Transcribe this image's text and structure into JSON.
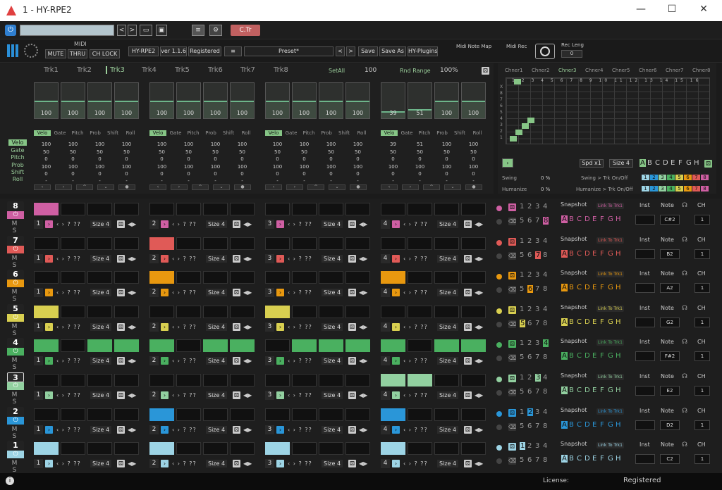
{
  "window": {
    "title": "1 - HY-RPE2",
    "min": "—",
    "max": "☐",
    "close": "✕"
  },
  "toolbar": {
    "ctr_label": "C.Tr",
    "prev": "<",
    "next": ">",
    "folder": "▭",
    "save": "▣"
  },
  "header": {
    "midi_label": "MIDI",
    "mute": "MUTE",
    "thru": "THRU",
    "chlock": "CH LOCK",
    "plugin": "HY-RPE2",
    "version": "ver 1.1.6",
    "registered": "Registered",
    "menu": "≡",
    "preset": "Preset*",
    "prev": "<",
    "next": ">",
    "save": "Save",
    "saveas": "Save As",
    "hyplugins": "HY-Plugins",
    "midinotemap": "Midi Note Map",
    "midirec": "Midi Rec",
    "recleng": "Rec Leng",
    "recleng_val": "0"
  },
  "tracks": {
    "tabs": [
      "Trk1",
      "Trk2",
      "Trk3",
      "Trk4",
      "Trk5",
      "Trk6",
      "Trk7",
      "Trk8"
    ],
    "active": "Trk3",
    "setall": "SetAll",
    "setall_val": "100",
    "rndrange": "Rnd Range",
    "rndrange_val": "100%",
    "sliders": [
      [
        "100",
        "100",
        "100",
        "100"
      ],
      [
        "100",
        "100",
        "100",
        "100"
      ],
      [
        "100",
        "100",
        "100",
        "100"
      ],
      [
        "39",
        "51",
        "100",
        "100"
      ]
    ],
    "fills": [
      [
        0.5,
        0.5,
        0.5,
        0.5
      ],
      [
        0.5,
        0.5,
        0.5,
        0.5
      ],
      [
        0.5,
        0.5,
        0.5,
        0.5
      ],
      [
        0.2,
        0.26,
        0.5,
        0.5
      ]
    ],
    "param_labels": [
      "Velo",
      "Gate",
      "Pitch",
      "Prob",
      "Shift",
      "Roll"
    ],
    "row_labels": [
      "Velo",
      "Gate",
      "Pitch",
      "Prob",
      "Shift",
      "Roll"
    ],
    "values": [
      [
        [
          "100",
          "100",
          "100",
          "100"
        ],
        [
          "50",
          "50",
          "50",
          "50"
        ],
        [
          "0",
          "0",
          "0",
          "0"
        ],
        [
          "100",
          "100",
          "100",
          "100"
        ],
        [
          "0",
          "0",
          "0",
          "0"
        ],
        [
          "-",
          "-",
          "-",
          "-"
        ]
      ],
      [
        [
          "100",
          "100",
          "100",
          "100"
        ],
        [
          "50",
          "50",
          "50",
          "50"
        ],
        [
          "0",
          "0",
          "0",
          "0"
        ],
        [
          "100",
          "100",
          "100",
          "100"
        ],
        [
          "0",
          "0",
          "0",
          "0"
        ],
        [
          "-",
          "-",
          "-",
          "-"
        ]
      ],
      [
        [
          "100",
          "100",
          "100",
          "100"
        ],
        [
          "50",
          "50",
          "50",
          "50"
        ],
        [
          "0",
          "0",
          "0",
          "0"
        ],
        [
          "100",
          "100",
          "100",
          "100"
        ],
        [
          "0",
          "0",
          "0",
          "0"
        ],
        [
          "-",
          "-",
          "-",
          "-"
        ]
      ],
      [
        [
          "39",
          "51",
          "100",
          "100"
        ],
        [
          "50",
          "50",
          "50",
          "50"
        ],
        [
          "0",
          "0",
          "0",
          "0"
        ],
        [
          "100",
          "100",
          "100",
          "100"
        ],
        [
          "0",
          "0",
          "0",
          "0"
        ],
        [
          "-",
          "-",
          "-",
          "-"
        ]
      ]
    ]
  },
  "channels": {
    "tabs": [
      "Chner1",
      "Chner2",
      "Chner3",
      "Chner4",
      "Chner5",
      "Chner6",
      "Chner7",
      "Chner8"
    ],
    "active": "Chner3",
    "grid_x": [
      "1",
      "2",
      "3",
      "4",
      "5",
      "6",
      "7",
      "8",
      "9",
      "10",
      "11",
      "12",
      "13",
      "14",
      "15",
      "16",
      "17",
      "18",
      "19",
      "20",
      "21",
      "22",
      "23",
      "24",
      "25",
      "26",
      "27",
      "28",
      "29",
      "30",
      "31",
      "32"
    ],
    "grid_y": [
      "X",
      "8",
      "7",
      "6",
      "5",
      "4",
      "3",
      "2",
      "1"
    ],
    "spd": "Spd x1",
    "size": "Size 4",
    "letters": [
      "A",
      "B",
      "C",
      "D",
      "E",
      "F",
      "G",
      "H"
    ],
    "swing": "Swing",
    "swing_val": "0 %",
    "swing_trk": "Swing > Trk On/Off",
    "humanize": "Humanize",
    "humanize_val": "0 %",
    "humanize_trk": "Humanize > Trk On/Off",
    "trk_nums": [
      "1",
      "2",
      "3",
      "4",
      "5",
      "6",
      "7",
      "8"
    ]
  },
  "rows": [
    {
      "ch": "8",
      "color": "#cf5fa3",
      "note": "C#2",
      "active": "8",
      "steps": [
        [
          1,
          0,
          0,
          0
        ],
        [
          0,
          0,
          0,
          0
        ],
        [
          0,
          0,
          0,
          0
        ],
        [
          0,
          0,
          0,
          0
        ]
      ]
    },
    {
      "ch": "7",
      "color": "#e05a57",
      "note": "B2",
      "active": "7",
      "steps": [
        [
          0,
          0,
          0,
          0
        ],
        [
          1,
          0,
          0,
          0
        ],
        [
          0,
          0,
          0,
          0
        ],
        [
          0,
          0,
          0,
          0
        ]
      ]
    },
    {
      "ch": "6",
      "color": "#e8980f",
      "note": "A2",
      "active": "6",
      "steps": [
        [
          0,
          0,
          0,
          0
        ],
        [
          1,
          0,
          0,
          0
        ],
        [
          0,
          0,
          0,
          0
        ],
        [
          1,
          0,
          0,
          0
        ]
      ]
    },
    {
      "ch": "5",
      "color": "#d8cf50",
      "note": "G2",
      "active": "5",
      "steps": [
        [
          1,
          0,
          0,
          0
        ],
        [
          0,
          0,
          0,
          0
        ],
        [
          1,
          0,
          0,
          0
        ],
        [
          0,
          0,
          0,
          0
        ]
      ]
    },
    {
      "ch": "4",
      "color": "#4ab060",
      "note": "F#2",
      "active": "4",
      "steps": [
        [
          1,
          0,
          1,
          1
        ],
        [
          1,
          0,
          1,
          1
        ],
        [
          0,
          1,
          1,
          1
        ],
        [
          1,
          0,
          1,
          1
        ]
      ]
    },
    {
      "ch": "3",
      "color": "#92d0a0",
      "note": "E2",
      "active": "3",
      "steps": [
        [
          0,
          0,
          0,
          0
        ],
        [
          0,
          0,
          0,
          0
        ],
        [
          0,
          0,
          0,
          0
        ],
        [
          1,
          1,
          0,
          0
        ]
      ]
    },
    {
      "ch": "2",
      "color": "#2a96d8",
      "note": "D2",
      "active": "2",
      "steps": [
        [
          0,
          0,
          0,
          0
        ],
        [
          1,
          0,
          0,
          0
        ],
        [
          0,
          0,
          0,
          0
        ],
        [
          1,
          0,
          0,
          0
        ]
      ]
    },
    {
      "ch": "1",
      "color": "#9dd4e5",
      "note": "C2",
      "active": "1",
      "steps": [
        [
          1,
          0,
          0,
          0
        ],
        [
          1,
          0,
          0,
          0
        ],
        [
          1,
          0,
          0,
          0
        ],
        [
          1,
          0,
          0,
          0
        ]
      ]
    }
  ],
  "row_ui": {
    "ms": "M S",
    "ctl": "‹ › ? ??",
    "size": "Size 4",
    "snapshot": "Snapshot",
    "link": "Link To Trk1",
    "inst": "Inst",
    "note": "Note",
    "ch": "CH",
    "ch_val": "1",
    "nums_top": "1234",
    "nums_bot": "5678",
    "letters": "ABCDEFGH"
  },
  "status": {
    "info": "i",
    "license": "License:",
    "registered": "Registered"
  }
}
